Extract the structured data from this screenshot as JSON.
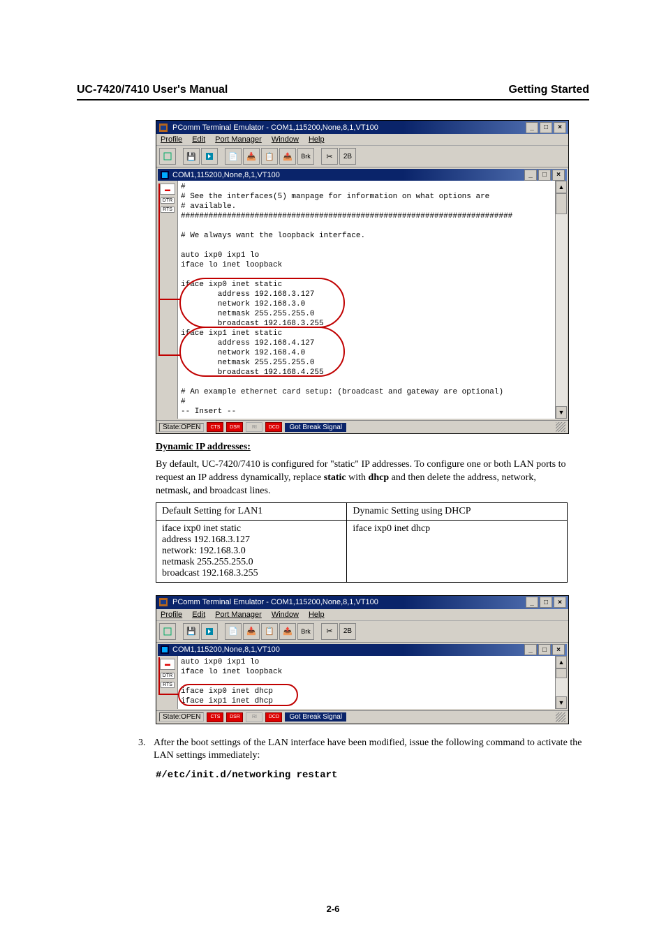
{
  "header": {
    "left": "UC-7420/7410 User's Manual",
    "right": "Getting Started"
  },
  "win1": {
    "title": "PComm Terminal Emulator - COM1,115200,None,8,1,VT100",
    "menu": [
      "Profile",
      "Edit",
      "Port Manager",
      "Window",
      "Help"
    ],
    "toolbar_labels": [
      "Brk",
      "2B"
    ],
    "inner_title": "COM1,115200,None,8,1,VT100",
    "gutter": {
      "labels": [
        "DTR",
        "RTS"
      ]
    },
    "term_text": "#\n# See the interfaces(5) manpage for information on what options are\n# available.\n########################################################################\n\n# We always want the loopback interface.\n\nauto ixp0 ixp1 lo\niface lo inet loopback\n\niface ixp0 inet static\n        address 192.168.3.127\n        network 192.168.3.0\n        netmask 255.255.255.0\n        broadcast 192.168.3.255\niface ixp1 inet static\n        address 192.168.4.127\n        network 192.168.4.0\n        netmask 255.255.255.0\n        broadcast 192.168.4.255\n\n# An example ethernet card setup: (broadcast and gateway are optional)\n#\n-- Insert --",
    "status": {
      "state": "State:OPEN",
      "leds": [
        "CTS",
        "DSR",
        "RI",
        "DCD"
      ],
      "msg": "Got Break Signal"
    }
  },
  "section": {
    "title": "Dynamic IP addresses:",
    "p1_a": "By default, UC-7420/7410 is configured for \"static\" IP addresses. To configure one or both LAN ports to request an IP address dynamically, replace ",
    "p1_b": "static",
    "p1_c": " with ",
    "p1_d": "dhcp",
    "p1_e": " and then delete the address, network, netmask, and broadcast lines."
  },
  "table": {
    "h1": "Default Setting for LAN1",
    "h2": "Dynamic Setting using DHCP",
    "c1_lines": [
      "iface ixp0 inet static",
      "address 192.168.3.127",
      "network: 192.168.3.0",
      "netmask 255.255.255.0",
      "broadcast 192.168.3.255"
    ],
    "c1_bold_idx": 0,
    "c2_a": "iface ixp0 inet ",
    "c2_b": "dhcp"
  },
  "win2": {
    "title": "PComm Terminal Emulator - COM1,115200,None,8,1,VT100",
    "menu": [
      "Profile",
      "Edit",
      "Port Manager",
      "Window",
      "Help"
    ],
    "toolbar_labels": [
      "Brk",
      "2B"
    ],
    "inner_title": "COM1,115200,None,8,1,VT100",
    "gutter": {
      "labels": [
        "DTR",
        "RTS"
      ]
    },
    "term_text": "auto ixp0 ixp1 lo\niface lo inet loopback\n\niface ixp0 inet dhcp\niface ixp1 inet dhcp",
    "status": {
      "state": "State:OPEN",
      "leds": [
        "CTS",
        "DSR",
        "RI",
        "DCD"
      ],
      "msg": "Got Break Signal"
    }
  },
  "step3": {
    "num": "3.",
    "text": "After the boot settings of the LAN interface have been modified, issue the following command to activate the LAN settings immediately:"
  },
  "command": "#/etc/init.d/networking restart",
  "page_number": "2-6",
  "chart_data": null
}
